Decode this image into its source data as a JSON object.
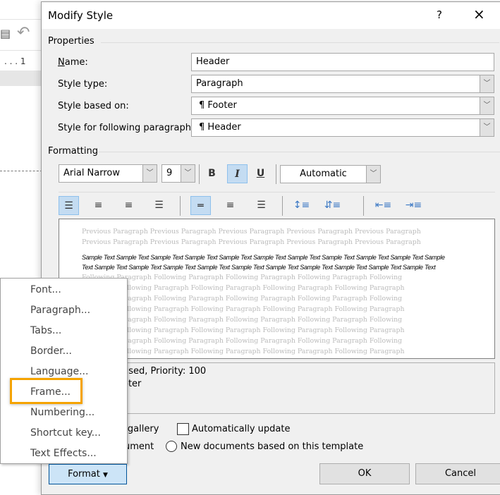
{
  "background": {
    "ruler_text": ". . . 1"
  },
  "dialog": {
    "title": "Modify Style",
    "help": "?",
    "close": "×",
    "properties": {
      "group_label": "Properties",
      "name_label": "Name:",
      "name_value": "Header",
      "style_type_label": "Style type:",
      "style_type_value": "Paragraph",
      "based_on_label": "Style based on:",
      "based_on_value": "Footer",
      "following_label": "Style for following paragraph:",
      "following_value": "Header",
      "pilcrow": "¶"
    },
    "formatting": {
      "group_label": "Formatting",
      "font": "Arial Narrow",
      "size": "9",
      "bold": "B",
      "italic": "I",
      "underline": "U",
      "color": "Automatic",
      "italic_active": true,
      "align_selected": "left",
      "spacing_selected": "single"
    },
    "preview": {
      "previous": "Previous Paragraph Previous Paragraph Previous Paragraph Previous Paragraph Previous Paragraph Previous Paragraph Previous Paragraph Previous Paragraph Previous Paragraph Previous Paragraph",
      "sample": "Sample Text Sample Text Sample Text Sample Text Sample Text Sample Text Sample Text Sample Text Sample Text Sample Text Sample Text Sample Text Sample Text Sample Text Sample Text Sample Text Sample Text Sample Text Sample Text Sample Text Sample Text",
      "following": "Following Paragraph Following Paragraph Following Paragraph Following Paragraph Following Paragraph Following Paragraph Following Paragraph Following Paragraph Following Paragraph Following Paragraph Following Paragraph Following Paragraph Following Paragraph Following Paragraph Following Paragraph Following Paragraph Following Paragraph Following Paragraph Following Paragraph Following Paragraph Following Paragraph Following Paragraph Following Paragraph Following Paragraph Following Paragraph Following Paragraph Following Paragraph Following Paragraph Following Paragraph Following Paragraph Following Paragraph Following Paragraph Following Paragraph Following Paragraph Following Paragraph Following Paragraph Following Paragraph Following Paragraph"
    },
    "description": {
      "line1": "used, Priority: 100",
      "line2": "oter"
    },
    "options": {
      "gallery_partial": "s gallery",
      "auto_update": "Automatically update",
      "document_partial": "ument",
      "new_docs": "New documents based on this template"
    },
    "ok": "OK",
    "cancel": "Cancel",
    "format": "Format"
  },
  "format_menu": {
    "items": [
      "Font...",
      "Paragraph...",
      "Tabs...",
      "Border...",
      "Language...",
      "Frame...",
      "Numbering...",
      "Shortcut key...",
      "Text Effects..."
    ],
    "highlighted": "Frame...",
    "highlight_color": "#f5a300"
  }
}
